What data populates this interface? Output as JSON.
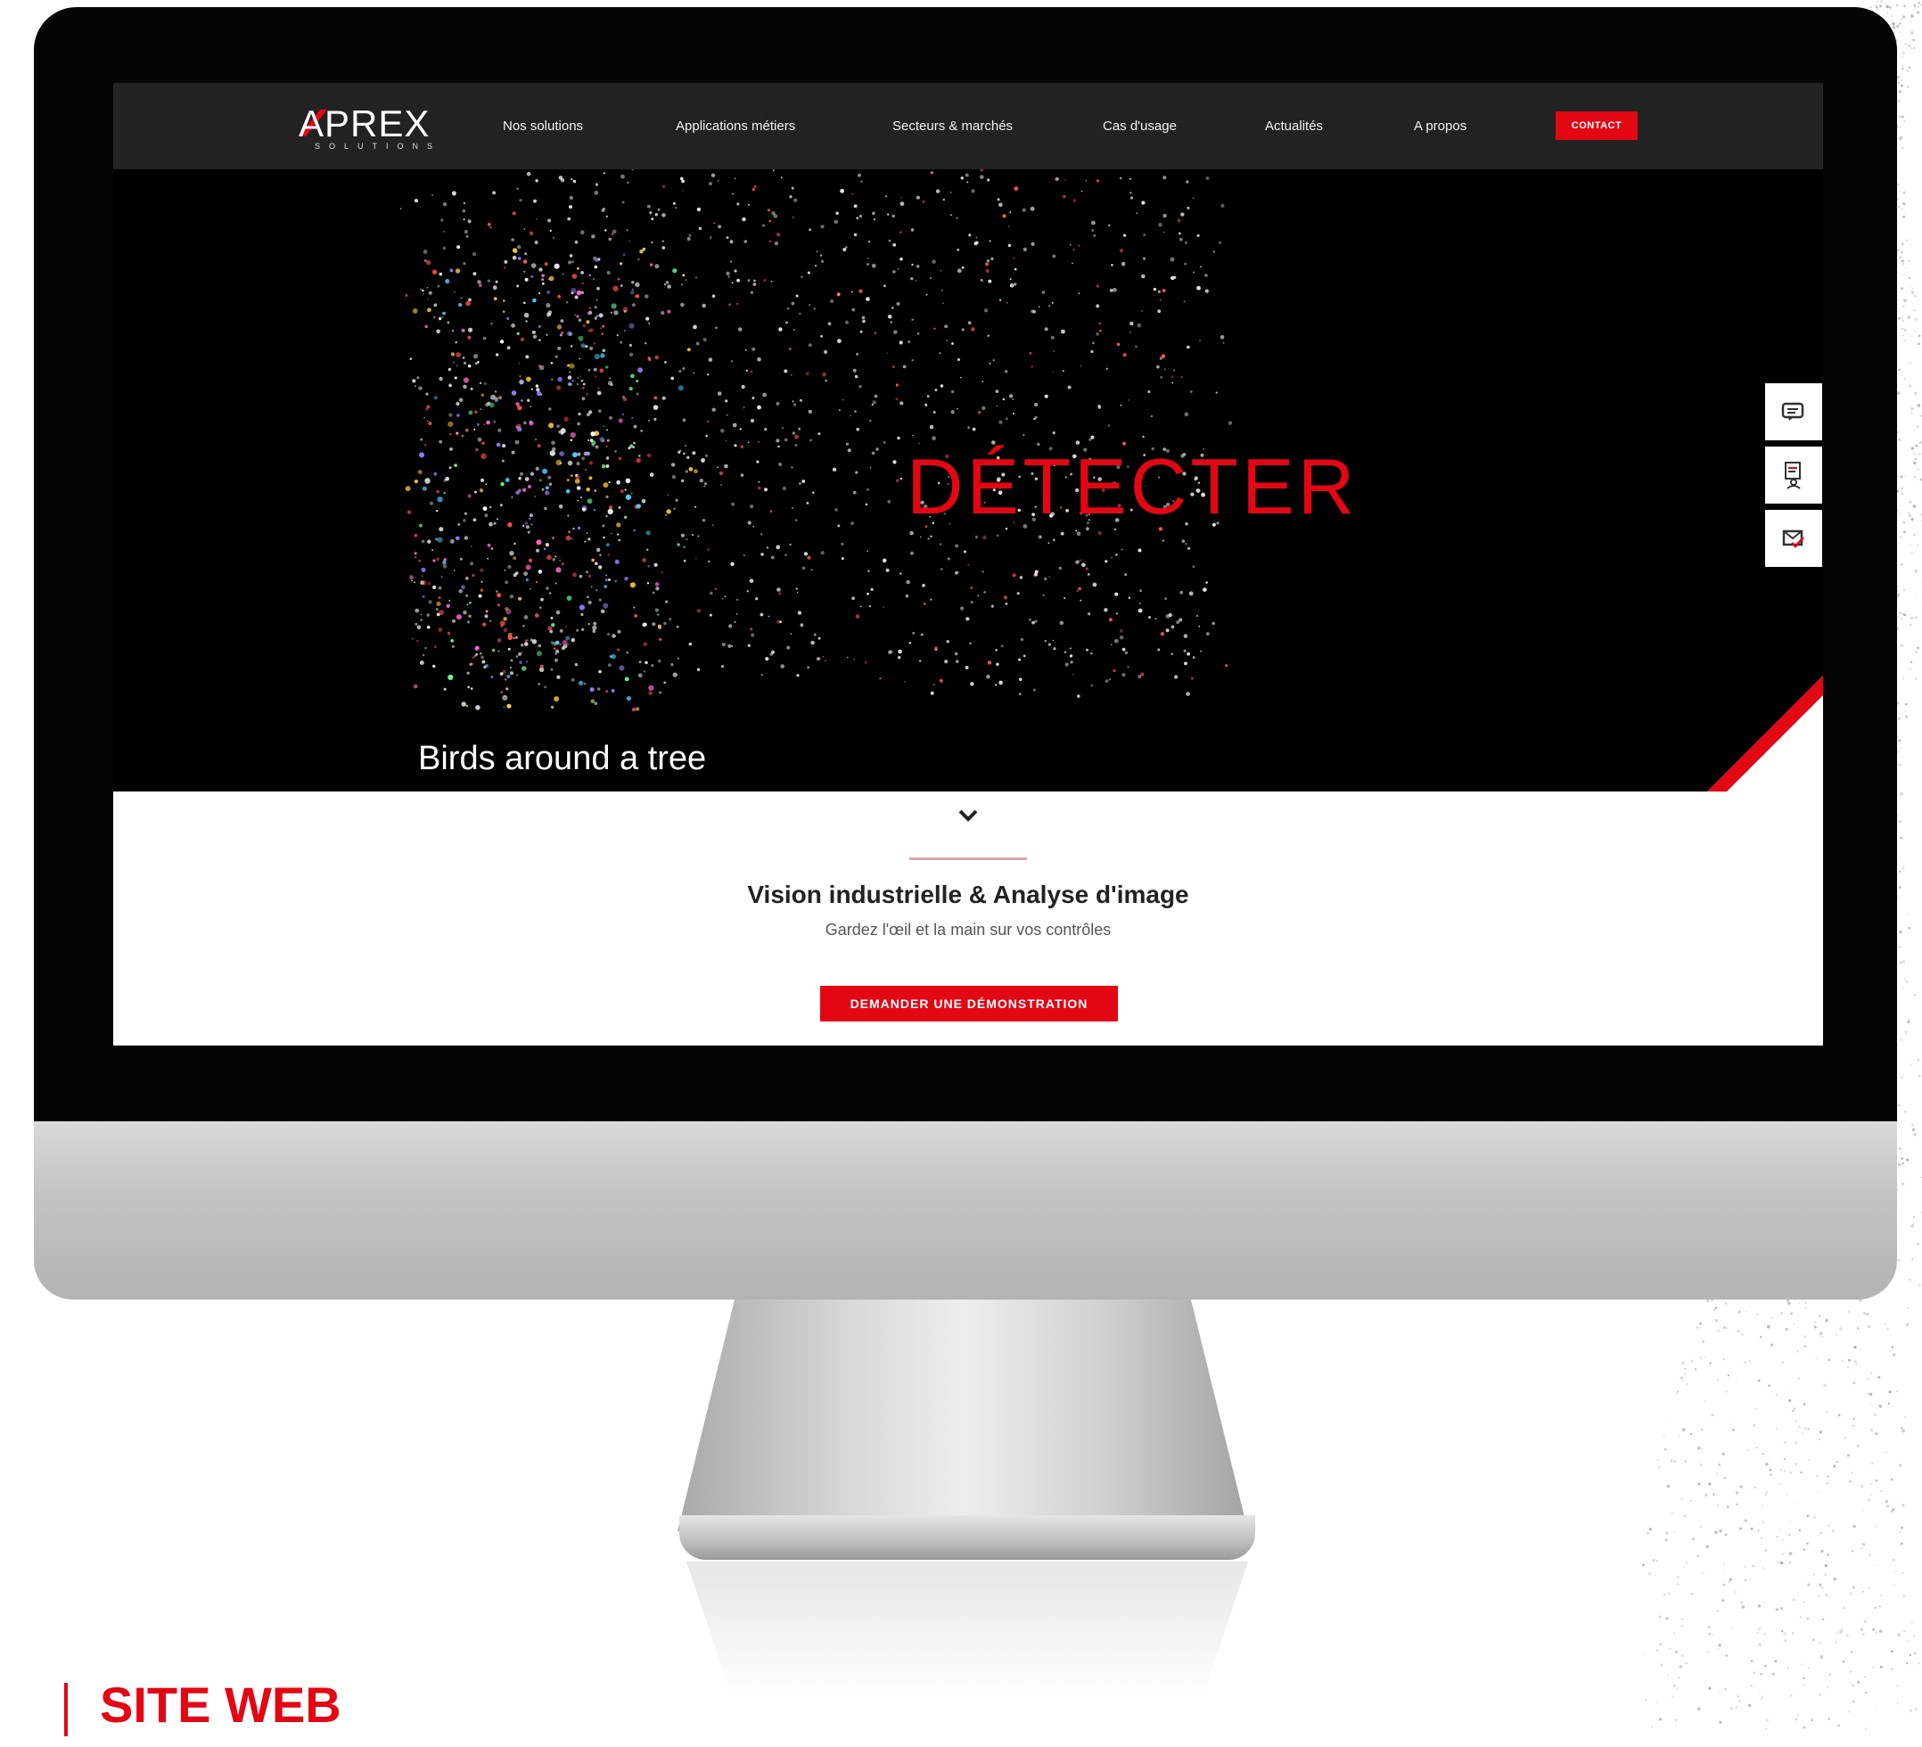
{
  "nav": {
    "logo_text": "APREX",
    "logo_sub": "SOLUTIONS",
    "items": [
      "Nos solutions",
      "Applications métiers",
      "Secteurs & marchés",
      "Cas d'usage",
      "Actualités",
      "A propos"
    ],
    "contact_label": "CONTACT"
  },
  "hero": {
    "word": "DÉTECTER",
    "caption": "Birds around a tree"
  },
  "side_tools": [
    "chat-icon",
    "document-user-icon",
    "mail-check-icon"
  ],
  "content": {
    "headline": "Vision industrielle & Analyse d'image",
    "subline": "Gardez l'œil et la main sur vos contrôles",
    "cta_label": "DEMANDER UNE DÉMONSTRATION"
  },
  "footer_label": "SITE WEB",
  "colors": {
    "accent": "#e30613",
    "nav_bg": "#222222",
    "hero_bg": "#000000"
  }
}
